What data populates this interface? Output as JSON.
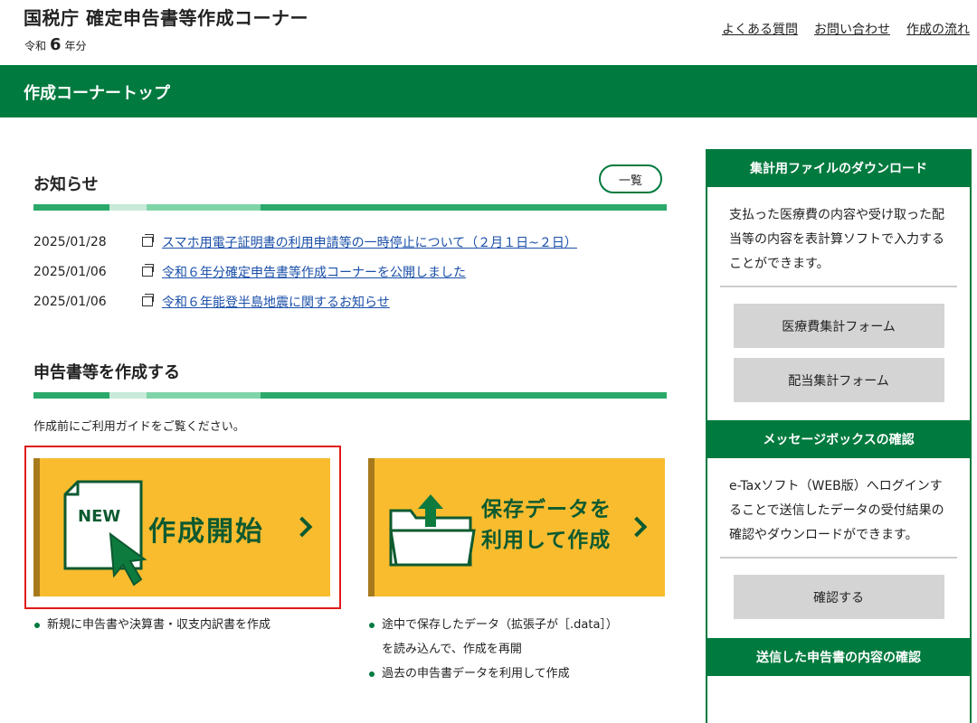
{
  "header": {
    "site_title": "国税庁 確定申告書等作成コーナー",
    "era": "令和",
    "year": "6",
    "year_suffix": "年分",
    "links": [
      "よくある質問",
      "お問い合わせ",
      "作成の流れ"
    ]
  },
  "bar_title": "作成コーナートップ",
  "news": {
    "heading": "お知らせ",
    "list_button": "一覧",
    "items": [
      {
        "date": "2025/01/28",
        "text": "スマホ用電子証明書の利用申請等の一時停止について（２月１日~２日）"
      },
      {
        "date": "2025/01/06",
        "text": "令和６年分確定申告書等作成コーナーを公開しました"
      },
      {
        "date": "2025/01/06",
        "text": "令和６年能登半島地震に関するお知らせ"
      }
    ]
  },
  "create": {
    "heading": "申告書等を作成する",
    "guide": "作成前にご利用ガイドをご覧ください。",
    "card1": {
      "label": "作成開始",
      "badge": "NEW"
    },
    "card2": {
      "line1": "保存データを",
      "line2": "利用して作成"
    },
    "bullets1": [
      "新規に申告書や決算書・収支内訳書を作成"
    ],
    "bullets2_a": "途中で保存したデータ（拡張子が［.data］）",
    "bullets2_a_cont": "を読み込んで、作成を再開",
    "bullets2_b": "過去の申告書データを利用して作成"
  },
  "sidebar": {
    "download_head": "集計用ファイルのダウンロード",
    "download_text": "支払った医療費の内容や受け取った配当等の内容を表計算ソフトで入力することができます。",
    "btn_medical": "医療費集計フォーム",
    "btn_dividend": "配当集計フォーム",
    "message_head": "メッセージボックスの確認",
    "message_text": "e-Taxソフト（WEB版）へログインすることで送信したデータの受付結果の確認やダウンロードができます。",
    "btn_confirm": "確認する",
    "sent_head": "送信した申告書の内容の確認"
  },
  "colors": {
    "brand_green": "#007a3e",
    "card_yellow": "#f8bc2e",
    "highlight_red": "#e01a1a"
  }
}
